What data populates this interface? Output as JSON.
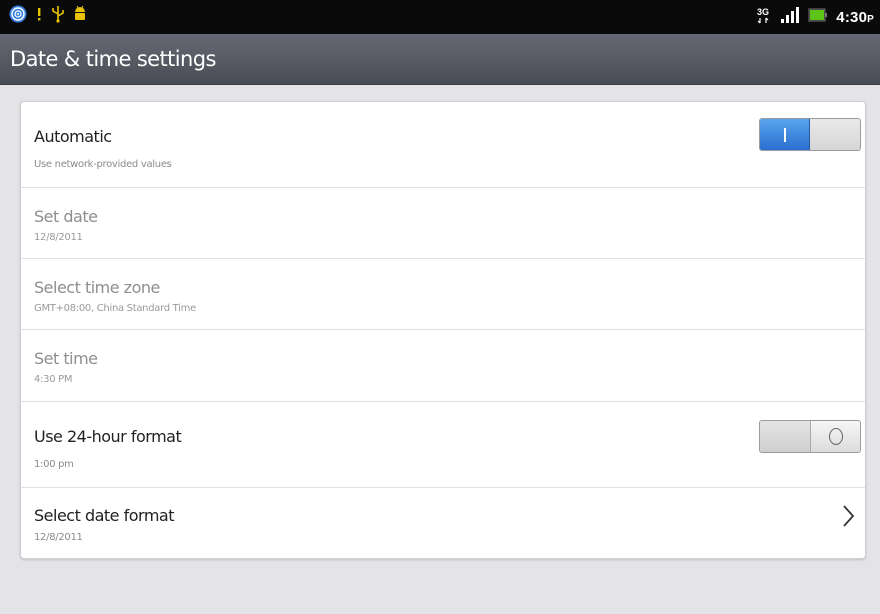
{
  "status_bar": {
    "time": "4:30",
    "time_suffix": "P",
    "network": "3G",
    "icons": [
      "target-icon",
      "warning-icon",
      "usb-icon",
      "android-debug-icon",
      "network-3g-icon",
      "signal-icon",
      "battery-icon"
    ]
  },
  "title_bar": {
    "title": "Date & time settings"
  },
  "settings": [
    {
      "title": "Automatic",
      "summary": "Use network-provided values",
      "enabled": true,
      "toggle": "on"
    },
    {
      "title": "Set date",
      "summary": "12/8/2011",
      "enabled": false
    },
    {
      "title": "Select time zone",
      "summary": "GMT+08:00, China Standard Time",
      "enabled": false
    },
    {
      "title": "Set time",
      "summary": "4:30 PM",
      "enabled": false
    },
    {
      "title": "Use 24-hour format",
      "summary": "1:00 pm",
      "enabled": true,
      "toggle": "off"
    },
    {
      "title": "Select date format",
      "summary": "12/8/2011",
      "enabled": true,
      "chevron": "chevron-right-icon"
    }
  ],
  "colors": {
    "accent": "#2a6fd0",
    "title_bar": "#55575f",
    "background": "#e4e4e7"
  }
}
